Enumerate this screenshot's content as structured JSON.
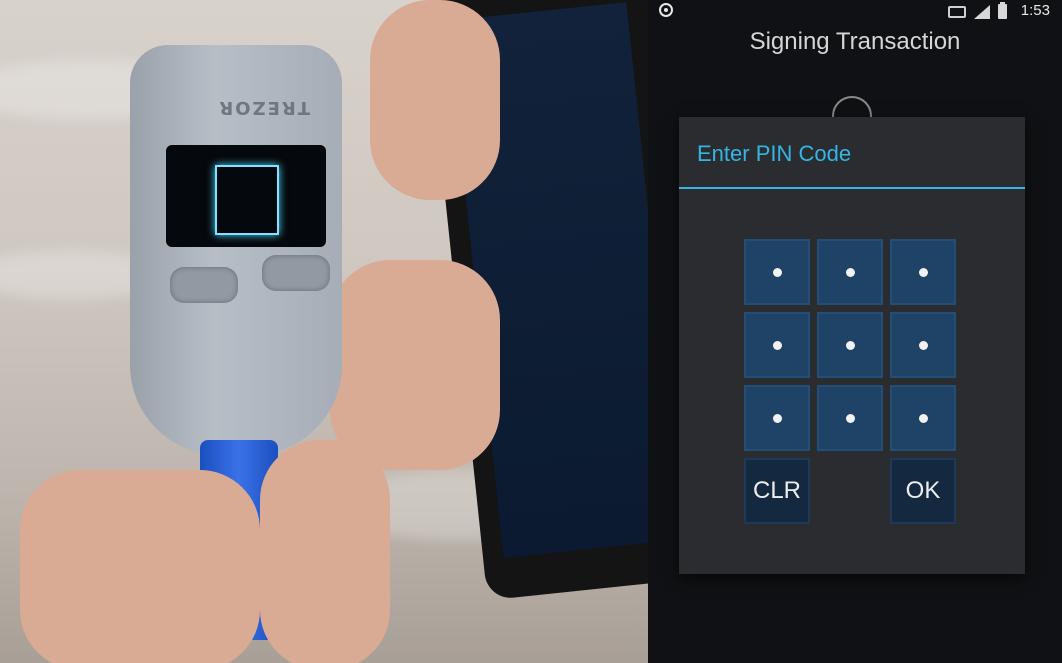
{
  "status_bar": {
    "time": "1:53",
    "left_icon": "record-icon",
    "icons": [
      "cast-icon",
      "signal-icon",
      "battery-icon"
    ]
  },
  "app": {
    "title": "Signing Transaction"
  },
  "pin_dialog": {
    "title": "Enter PIN Code",
    "accent_color": "#33b5e5",
    "key_color": "#1f4366",
    "keys": [
      "•",
      "•",
      "•",
      "•",
      "•",
      "•",
      "•",
      "•",
      "•"
    ],
    "clear_label": "CLR",
    "ok_label": "OK"
  },
  "device": {
    "logo": "TREZOR"
  }
}
